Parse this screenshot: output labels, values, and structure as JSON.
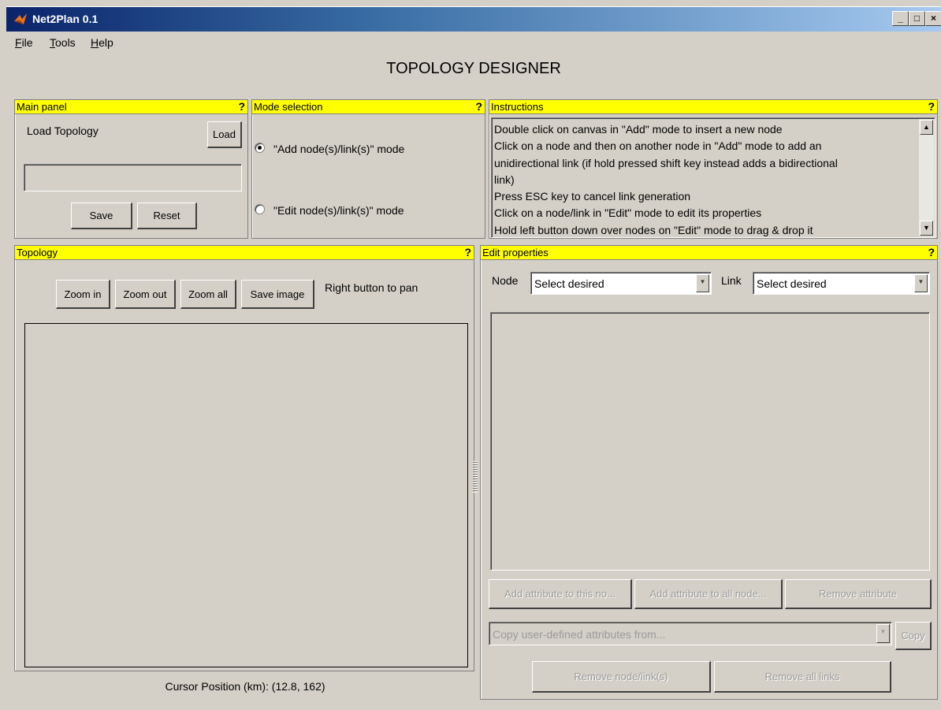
{
  "window": {
    "title": "Net2Plan 0.1",
    "min": "_",
    "max": "□",
    "close": "×"
  },
  "menu": [
    {
      "label": "File",
      "key": "F",
      "rest": "ile"
    },
    {
      "label": "Tools",
      "key": "T",
      "rest": "ools"
    },
    {
      "label": "Help",
      "key": "H",
      "rest": "elp"
    }
  ],
  "app_title": "TOPOLOGY DESIGNER",
  "main_panel": {
    "title": "Main panel",
    "help": "?",
    "load_label": "Load Topology",
    "load_button": "Load",
    "path_value": "",
    "save_button": "Save",
    "reset_button": "Reset"
  },
  "mode_panel": {
    "title": "Mode selection",
    "help": "?",
    "add_mode": "\"Add node(s)/link(s)\" mode",
    "edit_mode": "\"Edit node(s)/link(s)\" mode",
    "selected": "add"
  },
  "instructions_panel": {
    "title": "Instructions",
    "help": "?",
    "lines": [
      "Double click on canvas in \"Add\" mode to insert a new node",
      "Click on a node and then on another node in \"Add\" mode to add an",
      "unidirectional link (if hold pressed shift key instead adds a bidirectional",
      "link)",
      "Press ESC key to cancel link generation",
      "Click on a node/link in \"Edit\" mode to edit its properties",
      "Hold left button down over nodes on \"Edit\" mode to drag & drop it"
    ]
  },
  "topology_panel": {
    "title": "Topology",
    "help": "?",
    "zoom_in": "Zoom in",
    "zoom_out": "Zoom out",
    "zoom_all": "Zoom all",
    "save_image": "Save image",
    "pan_hint": "Right button to pan",
    "cursor_position": "Cursor Position (km): (12.8, 162)"
  },
  "edit_panel": {
    "title": "Edit properties",
    "help": "?",
    "node_label": "Node",
    "node_select": "Select desired",
    "link_label": "Link",
    "link_select": "Select desired",
    "add_attr_this": "Add attribute to this no...",
    "add_attr_all": "Add attribute to all node...",
    "remove_attr": "Remove attribute",
    "copy_from": "Copy user-defined attributes from...",
    "copy_button": "Copy",
    "remove_node_link": "Remove node/link(s)",
    "remove_all_links": "Remove all links"
  }
}
